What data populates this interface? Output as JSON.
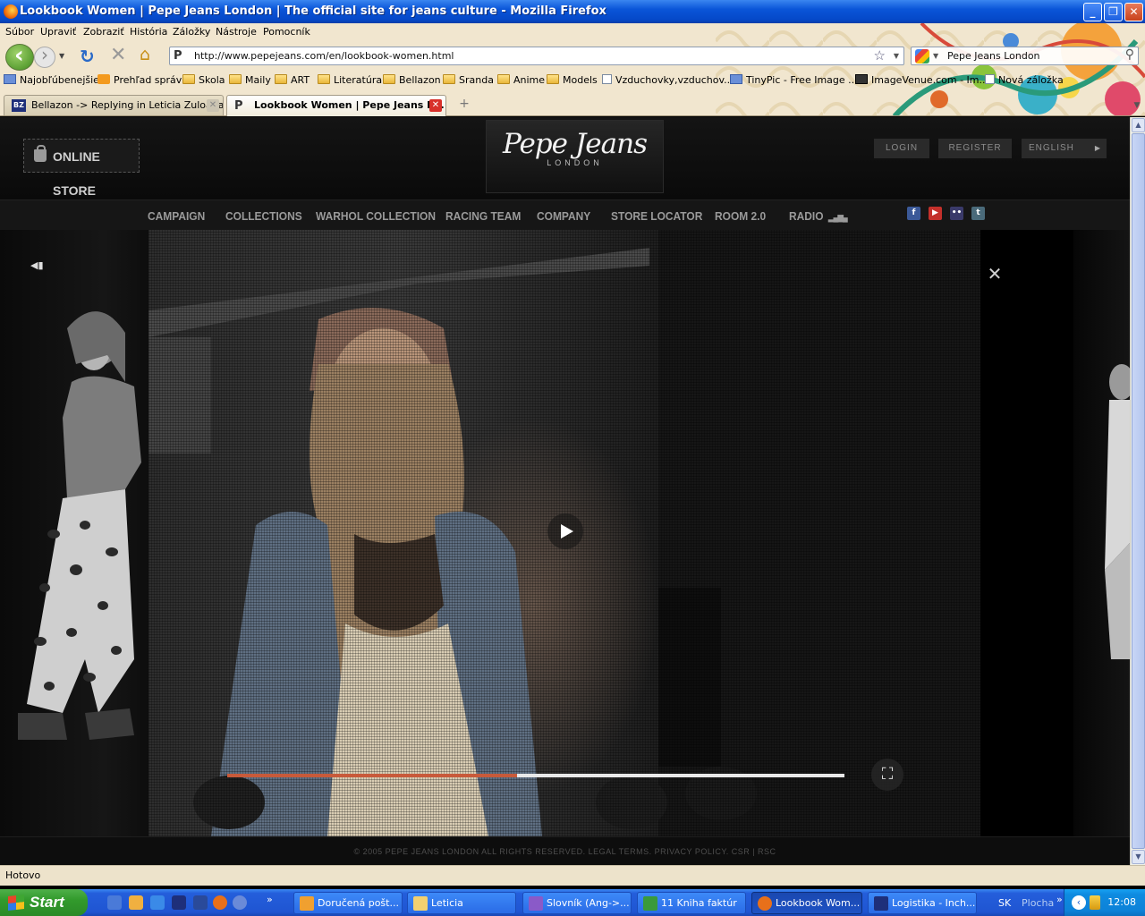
{
  "window": {
    "title": "Lookbook Women | Pepe Jeans London | The official site for jeans culture - Mozilla Firefox",
    "min_glyph": "_",
    "max_glyph": "❐",
    "close_glyph": "✕"
  },
  "menubar": [
    "Súbor",
    "Upraviť",
    "Zobraziť",
    "História",
    "Záložky",
    "Nástroje",
    "Pomocník"
  ],
  "navbar": {
    "url": "http://www.pepejeans.com/en/lookbook-women.html",
    "search_text": "Pepe Jeans London"
  },
  "bookmarks": [
    {
      "label": "Najobľúbenejšie",
      "icon": "bookmark-icon"
    },
    {
      "label": "Prehľad správ",
      "icon": "rss-icon"
    },
    {
      "label": "Skola",
      "icon": "folder-icon"
    },
    {
      "label": "Maily",
      "icon": "folder-icon"
    },
    {
      "label": "ART",
      "icon": "folder-icon"
    },
    {
      "label": "Literatúra",
      "icon": "folder-icon"
    },
    {
      "label": "Bellazon",
      "icon": "folder-icon"
    },
    {
      "label": "Sranda",
      "icon": "folder-icon"
    },
    {
      "label": "Anime",
      "icon": "folder-icon"
    },
    {
      "label": "Models",
      "icon": "folder-icon"
    },
    {
      "label": "Vzduchovky,vzduchov...",
      "icon": "page-icon"
    },
    {
      "label": "TinyPic - Free Image ...",
      "icon": "tinypic-icon"
    },
    {
      "label": "ImageVenue.com - Im...",
      "icon": "imagevenue-icon"
    },
    {
      "label": "Nová záložka",
      "icon": "page-icon"
    }
  ],
  "tabs": [
    {
      "label": "Bellazon -> Replying in Leticia Zuloaga",
      "favicon": "BZ"
    },
    {
      "label": "Lookbook Women | Pepe Jeans L...",
      "favicon": "pepe"
    }
  ],
  "site": {
    "online_store": "ONLINE STORE",
    "brand": "Pepe Jeans",
    "brand_sub": "LONDON",
    "login": "LOGIN",
    "register": "REGISTER",
    "language": "ENGLISH",
    "nav": [
      "CAMPAIGN",
      "COLLECTIONS",
      "WARHOL COLLECTION",
      "RACING TEAM",
      "COMPANY",
      "STORE LOCATOR",
      "ROOM 2.0",
      "RADIO"
    ],
    "social": [
      {
        "name": "facebook-icon",
        "glyph": "f",
        "color": "#3b5998"
      },
      {
        "name": "youtube-icon",
        "glyph": "▶",
        "color": "#c4302b"
      },
      {
        "name": "flickr-icon",
        "glyph": "••",
        "color": "#3a3a6a"
      },
      {
        "name": "twitter-icon",
        "glyph": "t",
        "color": "#4a6a7a"
      }
    ],
    "footer": "© 2005 PEPE JEANS LONDON ALL RIGHTS RESERVED. LEGAL TERMS. PRIVACY POLICY. CSR | RSC"
  },
  "video": {
    "progress": 0.47,
    "accent_color": "#c85a3a"
  },
  "status": "Hotovo",
  "taskbar": {
    "start": "Start",
    "tasks": [
      {
        "label": "Doručená pošt...",
        "color": "#f0a030"
      },
      {
        "label": "Leticia",
        "color": "#f2d070"
      },
      {
        "label": "Slovník (Ang->...",
        "color": "#8a5ac8"
      },
      {
        "label": "11 Kniha faktúr",
        "color": "#3a9a3a"
      },
      {
        "label": "Lookbook Wom...",
        "color": "#e8701a"
      },
      {
        "label": "Logistika - Inch...",
        "color": "#1e2f7a"
      }
    ],
    "language": "SK",
    "desktop": "Plocha",
    "clock": "12:08"
  }
}
